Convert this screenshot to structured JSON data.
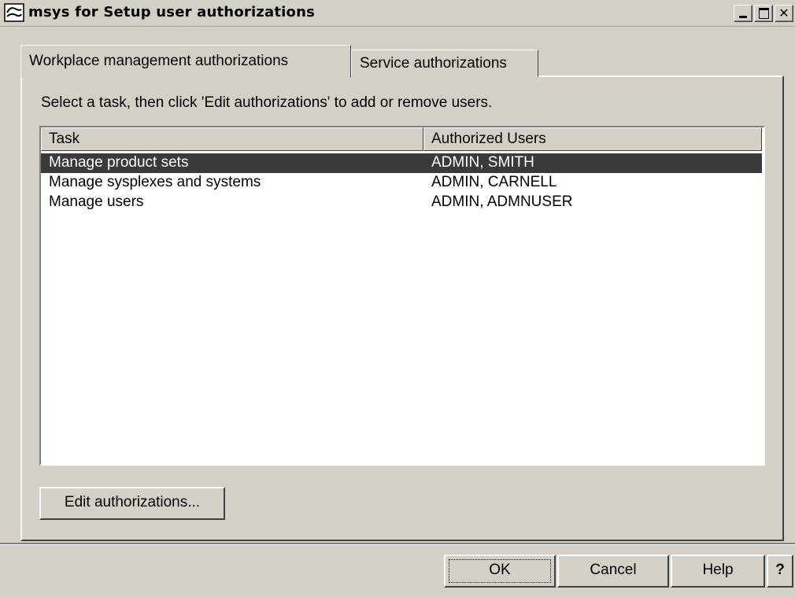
{
  "window": {
    "title": "msys for Setup user authorizations",
    "icon": "msys-app-icon"
  },
  "tabs": [
    {
      "label": "Workplace management authorizations",
      "active": true
    },
    {
      "label": "Service authorizations",
      "active": false
    }
  ],
  "instruction": "Select a task, then click 'Edit authorizations' to add or remove users.",
  "table": {
    "columns": [
      "Task",
      "Authorized Users"
    ],
    "rows": [
      {
        "task": "Manage product sets",
        "users": "ADMIN, SMITH",
        "selected": true
      },
      {
        "task": "Manage sysplexes and systems",
        "users": "ADMIN, CARNELL",
        "selected": false
      },
      {
        "task": "Manage users",
        "users": "ADMIN, ADMNUSER",
        "selected": false
      }
    ]
  },
  "buttons": {
    "edit": "Edit authorizations...",
    "ok": "OK",
    "cancel": "Cancel",
    "help": "Help",
    "context_help": "?"
  },
  "colors": {
    "face": "#d4d0c8",
    "selection": "#3a3a3a"
  }
}
